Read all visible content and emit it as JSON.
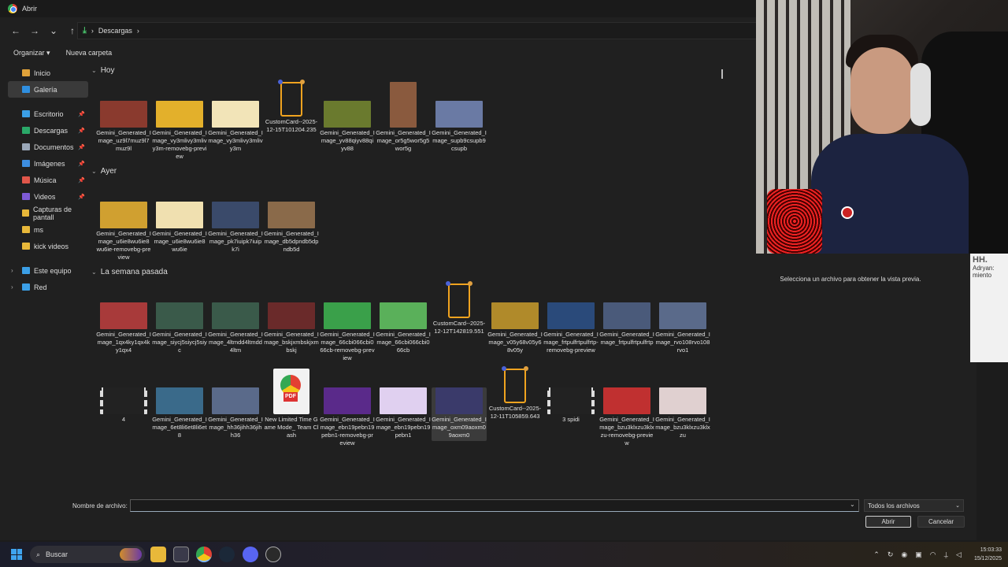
{
  "window": {
    "title": "Abrir"
  },
  "nav": {
    "path": "Descargas"
  },
  "toolbar": {
    "organize": "Organizar",
    "new_folder": "Nueva carpeta"
  },
  "sidebar": {
    "items": [
      {
        "label": "Inicio",
        "icon": "home-icon",
        "pinned": false,
        "active": false,
        "color": "#e0a23a"
      },
      {
        "label": "Galería",
        "icon": "gallery-icon",
        "pinned": false,
        "active": true,
        "color": "#2f8fe0"
      },
      {
        "label": "Escritorio",
        "icon": "desktop-icon",
        "pinned": true,
        "active": false,
        "color": "#3b9fe6"
      },
      {
        "label": "Descargas",
        "icon": "download-icon",
        "pinned": true,
        "active": false,
        "color": "#2aa868"
      },
      {
        "label": "Documentos",
        "icon": "document-icon",
        "pinned": true,
        "active": false,
        "color": "#9aa7b8"
      },
      {
        "label": "Imágenes",
        "icon": "images-icon",
        "pinned": true,
        "active": false,
        "color": "#3d8ee0"
      },
      {
        "label": "Música",
        "icon": "music-icon",
        "pinned": true,
        "active": false,
        "color": "#e0564a"
      },
      {
        "label": "Videos",
        "icon": "videos-icon",
        "pinned": true,
        "active": false,
        "color": "#7e5ad6"
      },
      {
        "label": "Capturas de pantall",
        "icon": "folder-icon",
        "pinned": false,
        "active": false,
        "color": "#e8b83a"
      },
      {
        "label": "ms",
        "icon": "folder-icon",
        "pinned": false,
        "active": false,
        "color": "#e8b83a"
      },
      {
        "label": "kick videos",
        "icon": "folder-icon",
        "pinned": false,
        "active": false,
        "color": "#e8b83a"
      }
    ],
    "this_pc": "Este equipo",
    "network": "Red"
  },
  "groups": [
    {
      "label": "Hoy",
      "files": [
        {
          "name": "Gemini_Generated_Image_uz9l7muz9l7muz9l",
          "kind": "image",
          "color": "#8a3a2e"
        },
        {
          "name": "Gemini_Generated_Image_vy3mlivy3mlivy3m-removebg-preview",
          "kind": "image",
          "color": "#e3b02b"
        },
        {
          "name": "Gemini_Generated_Image_vy3mlivy3mlivy3m",
          "kind": "image",
          "color": "#f2e4b8"
        },
        {
          "name": "CustomCard--2025-12-15T101204.235",
          "kind": "card",
          "color": "#f0a31f"
        },
        {
          "name": "Gemini_Generated_Image_yv88qiyv88qiyv88",
          "kind": "image",
          "color": "#6a7a2e"
        },
        {
          "name": "Gemini_Generated_Image_or5g5wor5g5wor5g",
          "kind": "tall",
          "color": "#8a5a3e"
        },
        {
          "name": "Gemini_Generated_Image_supb9csupb9csupb",
          "kind": "image",
          "color": "#6a7aa4"
        }
      ]
    },
    {
      "label": "Ayer",
      "files": [
        {
          "name": "Gemini_Generated_Image_u6ie8wu6ie8wu6ie-removebg-preview",
          "kind": "image",
          "color": "#d0a030"
        },
        {
          "name": "Gemini_Generated_Image_u6ie8wu6ie8wu6ie",
          "kind": "image",
          "color": "#f0e0b0"
        },
        {
          "name": "Gemini_Generated_Image_pk7iuipk7iuipk7i",
          "kind": "image",
          "color": "#3a4a6a"
        },
        {
          "name": "Gemini_Generated_Image_db5dpndb5dpndb5d",
          "kind": "image",
          "color": "#8a6a4a"
        }
      ]
    },
    {
      "label": "La semana pasada",
      "files": [
        {
          "name": "Gemini_Generated_Image_1qx4ky1qx4ky1qx4",
          "kind": "image",
          "color": "#a83a3a"
        },
        {
          "name": "Gemini_Generated_Image_siycj5siycj5siyc",
          "kind": "image",
          "color": "#3a5a4a"
        },
        {
          "name": "Gemini_Generated_Image_4ltmdd4ltmdd4ltm",
          "kind": "image",
          "color": "#3a5a4a"
        },
        {
          "name": "Gemini_Generated_Image_bskjxmbskjxmbskj",
          "kind": "image",
          "color": "#6a2a2a"
        },
        {
          "name": "Gemini_Generated_Image_66cbi066cbi066cb-removebg-preview",
          "kind": "image",
          "color": "#3aa04a"
        },
        {
          "name": "Gemini_Generated_Image_66cbi066cbi066cb",
          "kind": "image",
          "color": "#5ab05a"
        },
        {
          "name": "CustomCard--2025-12-12T142819.551",
          "kind": "card",
          "color": "#f0a31f"
        },
        {
          "name": "Gemini_Generated_Image_v05y68v05y68v05y",
          "kind": "image",
          "color": "#b08a2a"
        },
        {
          "name": "Gemini_Generated_Image_frtpulfrtpulfrtp-removebg-preview",
          "kind": "image",
          "color": "#2a4a7a"
        },
        {
          "name": "Gemini_Generated_Image_frtpulfrtpulfrtp",
          "kind": "image",
          "color": "#4a5a7a"
        },
        {
          "name": "Gemini_Generated_Image_rvo108rvo108rvo1",
          "kind": "image",
          "color": "#5a6a8a"
        },
        {
          "name": "4",
          "kind": "video",
          "color": "#222222"
        },
        {
          "name": "Gemini_Generated_Image_6et8li6et8li6et8",
          "kind": "image",
          "color": "#3a6a8a"
        },
        {
          "name": "Gemini_Generated_Image_hh36jihh36jihh36",
          "kind": "image",
          "color": "#5a6a8a"
        },
        {
          "name": "New Limited Time Game Mode_ Team Clash",
          "kind": "pdf",
          "color": "#f2f2f2"
        },
        {
          "name": "Gemini_Generated_Image_ebn19pebn19pebn1-removebg-preview",
          "kind": "image",
          "color": "#5a2a8a"
        },
        {
          "name": "Gemini_Generated_Image_ebn19pebn19pebn1",
          "kind": "image",
          "color": "#e0d0f0"
        },
        {
          "name": "Gemini_Generated_Image_oxm09aoxm09aoxm0",
          "kind": "image",
          "color": "#3a3a6a",
          "selected": true
        },
        {
          "name": "CustomCard--2025-12-11T105859.643",
          "kind": "card",
          "color": "#f0a31f"
        },
        {
          "name": "3 spidi",
          "kind": "video",
          "color": "#222222"
        },
        {
          "name": "Gemini_Generated_Image_bzu3klxzu3klxzu-removebg-preview",
          "kind": "image",
          "color": "#c03030"
        },
        {
          "name": "Gemini_Generated_Image_bzu3klxzu3klxzu",
          "kind": "image",
          "color": "#e0d0d0"
        }
      ]
    }
  ],
  "preview": {
    "message": "Selecciona un archivo para obtener la vista previa."
  },
  "footer": {
    "filename_label": "Nombre de archivo:",
    "filename_value": "",
    "filetype": "Todos los archivos",
    "open": "Abrir",
    "cancel": "Cancelar"
  },
  "overlay": {
    "text_big": "HH.",
    "text_small1": "Adryan:",
    "text_small2": "miento"
  },
  "taskbar": {
    "search_placeholder": "Buscar",
    "time": "15:03:33",
    "date": "15/12/2025"
  }
}
